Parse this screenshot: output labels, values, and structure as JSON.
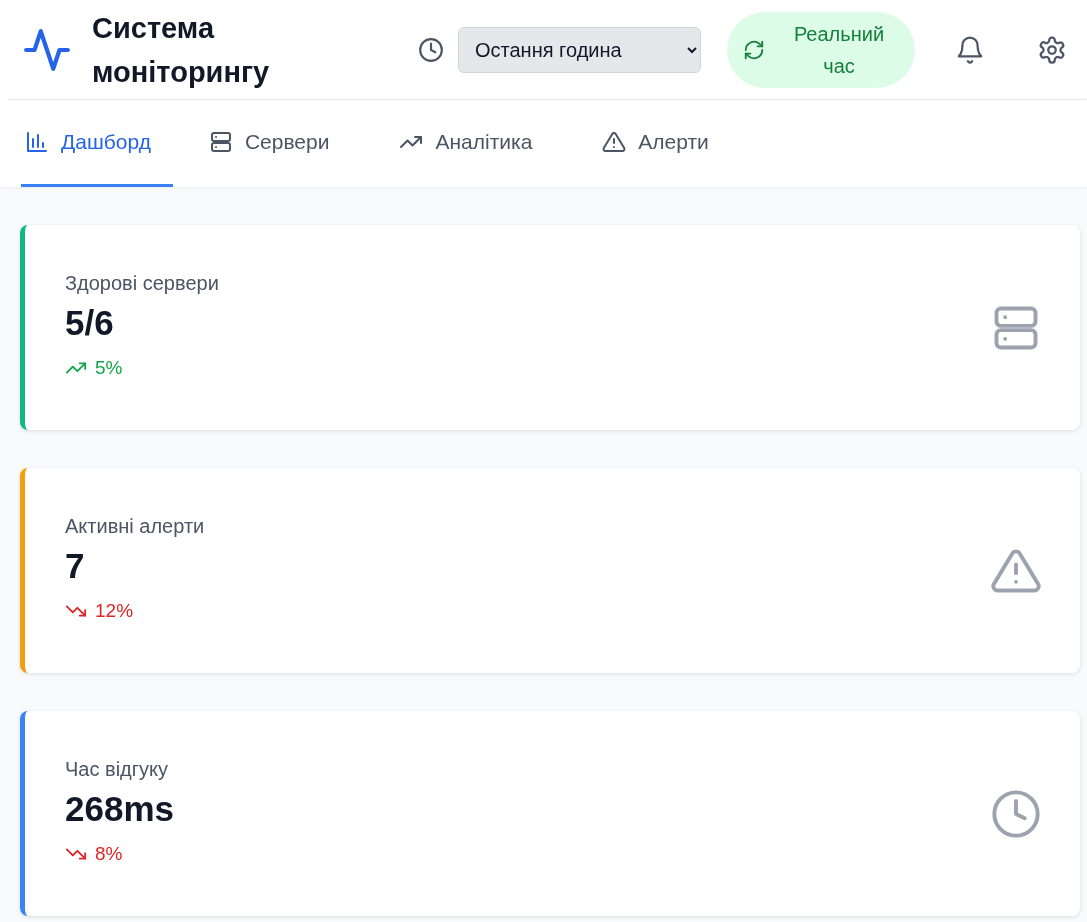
{
  "header": {
    "title": "Система моніторингу",
    "time_range": "Остання година",
    "live": {
      "label": "Реальний час",
      "on": true
    }
  },
  "tabs": [
    {
      "label": "Дашборд",
      "kind": "chart",
      "selected": true
    },
    {
      "label": "Сервери",
      "kind": "servers",
      "selected": false
    },
    {
      "label": "Аналітика",
      "kind": "trend",
      "selected": false
    },
    {
      "label": "Алерти",
      "kind": "alert",
      "selected": false
    }
  ],
  "cards": [
    {
      "label": "Здорові сервери",
      "value": "5/6",
      "change": "5%",
      "rising": true,
      "color": "#10b981",
      "kind": "servers"
    },
    {
      "label": "Активні алерти",
      "value": "7",
      "change": "12%",
      "rising": false,
      "color": "#f59e0b",
      "kind": "alert"
    },
    {
      "label": "Час відгуку",
      "value": "268ms",
      "change": "8%",
      "rising": false,
      "color": "#3b82f6",
      "kind": "clock"
    }
  ]
}
